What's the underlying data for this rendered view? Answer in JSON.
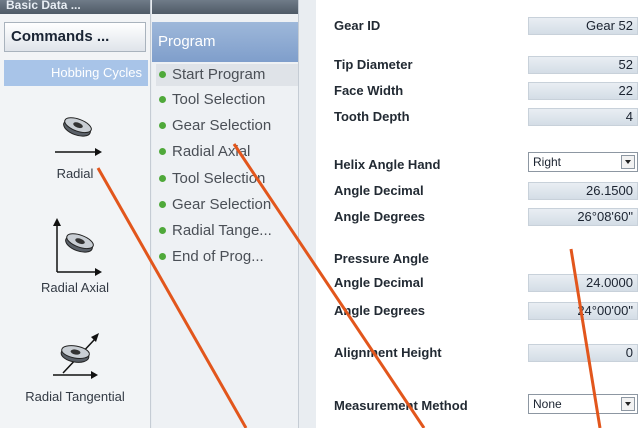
{
  "left": {
    "top_strip_label": "Basic Data ...",
    "commands_label": "Commands ...",
    "section_label": "Hobbing Cycles",
    "cycles": [
      {
        "label": "Radial",
        "icon": "radial-cycle-icon"
      },
      {
        "label": "Radial Axial",
        "icon": "radial-axial-cycle-icon"
      },
      {
        "label": "Radial Tangential",
        "icon": "radial-tangential-cycle-icon"
      }
    ]
  },
  "middle": {
    "header": "Program",
    "steps": [
      "Start Program",
      "Tool Selection",
      "Gear Selection",
      "Radial Axial",
      "Tool Selection",
      "Gear Selection",
      "Radial Tange...",
      "End of Prog..."
    ]
  },
  "right": {
    "gear_id": {
      "label": "Gear ID",
      "value": "Gear 52"
    },
    "tip_diameter": {
      "label": "Tip Diameter",
      "value": "52"
    },
    "face_width": {
      "label": "Face Width",
      "value": "22"
    },
    "tooth_depth": {
      "label": "Tooth Depth",
      "value": "4"
    },
    "helix_hand": {
      "label": "Helix Angle Hand",
      "value": "Right"
    },
    "helix_decimal": {
      "label": "Angle Decimal",
      "value": "26.1500"
    },
    "helix_degrees": {
      "label": "Angle Degrees",
      "value": "26°08'60\""
    },
    "pressure_title": "Pressure Angle",
    "pressure_decimal": {
      "label": "Angle Decimal",
      "value": "24.0000"
    },
    "pressure_degrees": {
      "label": "Angle Degrees",
      "value": "24°00'00\""
    },
    "alignment_height": {
      "label": "Alignment Height",
      "value": "0"
    },
    "measurement_method": {
      "label": "Measurement Method",
      "value": "None"
    }
  },
  "colors": {
    "callout_line": "#e2561c",
    "section_header_bg": "#a8c4e8",
    "program_header_bg": "#8fabd4",
    "status_dot": "#4fa93a"
  }
}
